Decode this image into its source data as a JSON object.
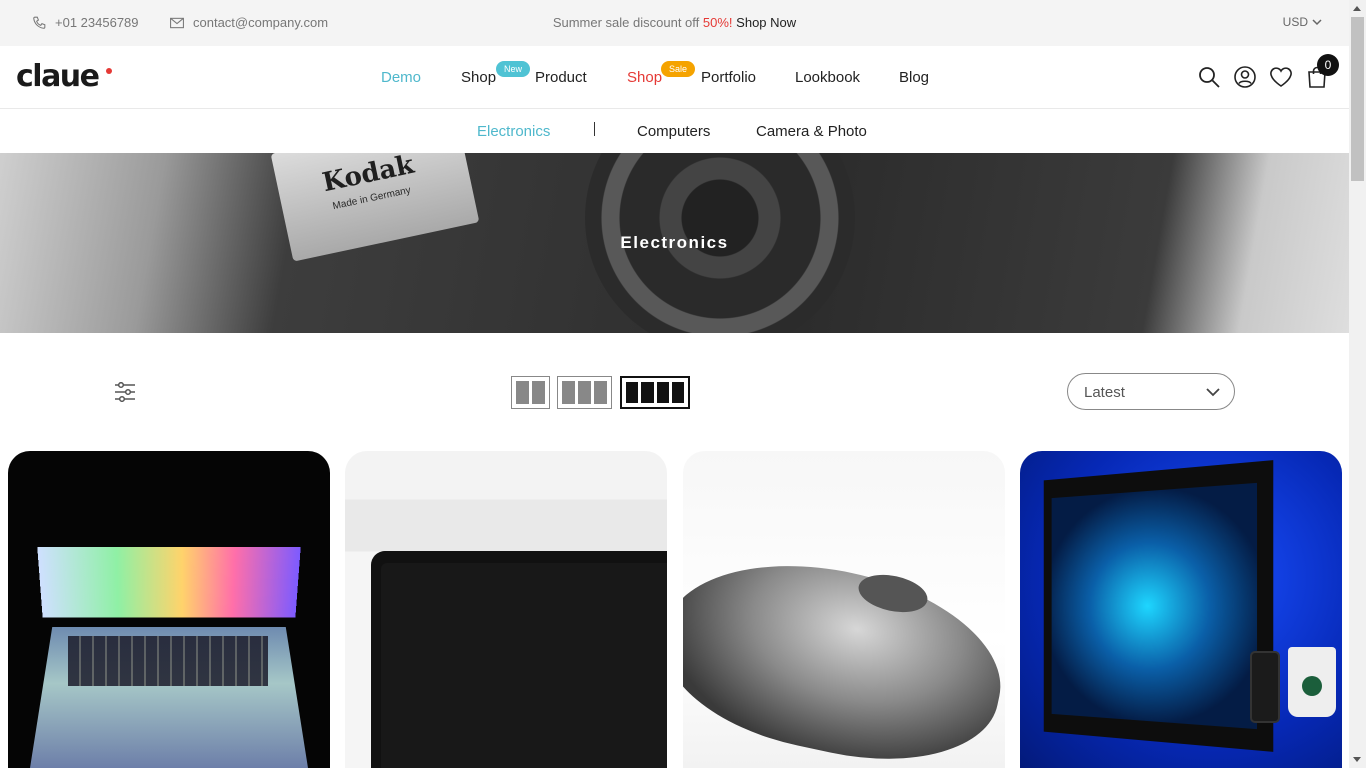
{
  "topbar": {
    "phone": "+01 23456789",
    "email": "contact@company.com",
    "promo_prefix": "Summer sale discount off",
    "promo_percent": "50%!",
    "promo_link": "Shop Now",
    "currency": "USD"
  },
  "header": {
    "logo": "claue",
    "nav": [
      {
        "label": "Demo"
      },
      {
        "label": "Shop",
        "badge": "New"
      },
      {
        "label": "Product"
      },
      {
        "label": "Shop",
        "badge": "Sale"
      },
      {
        "label": "Portfolio"
      },
      {
        "label": "Lookbook"
      },
      {
        "label": "Blog"
      }
    ],
    "cart_count": "0"
  },
  "subnav": {
    "items": [
      "Electronics",
      "Computers",
      "Camera & Photo"
    ]
  },
  "banner": {
    "title": "Electronics",
    "brand_text": "Kodak",
    "brand_sub": "Made in Germany"
  },
  "toolbar": {
    "sort_value": "Latest"
  },
  "colors": {
    "accent": "#4fb8cc",
    "sale": "#e53935",
    "badge_new": "#4fc3d4",
    "badge_sale": "#f5a300"
  }
}
